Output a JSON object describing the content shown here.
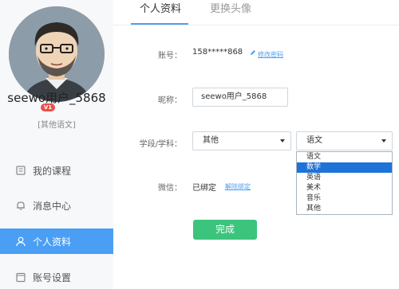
{
  "sidebar": {
    "username": "seewo用户_5868",
    "vip_badge": "V1",
    "subtitle": "[其他语文]",
    "nav": [
      {
        "label": "我的课程",
        "icon": "course-icon",
        "active": false
      },
      {
        "label": "消息中心",
        "icon": "bell-icon",
        "active": false
      },
      {
        "label": "个人资料",
        "icon": "user-icon",
        "active": true
      },
      {
        "label": "账号设置",
        "icon": "settings-icon",
        "active": false
      }
    ]
  },
  "tabs": [
    {
      "label": "个人资料",
      "active": true
    },
    {
      "label": "更换头像",
      "active": false
    }
  ],
  "form": {
    "account_label": "账号：",
    "account_value": "158*****868",
    "account_link": "修改密码",
    "nickname_label": "昵称：",
    "nickname_value": "seewo用户_5868",
    "stage_label": "学段/学科：",
    "stage_value": "其他",
    "subject_value": "语文",
    "subject_options": [
      "语文",
      "数学",
      "英语",
      "美术",
      "音乐",
      "其他"
    ],
    "subject_highlighted": "数学",
    "wechat_label": "微信：",
    "wechat_value": "已绑定",
    "wechat_link": "解除绑定",
    "done_label": "完成"
  },
  "colors": {
    "accent": "#4a9ff5",
    "done": "#3cc47c",
    "dropdown_highlight": "#1e73d8"
  }
}
